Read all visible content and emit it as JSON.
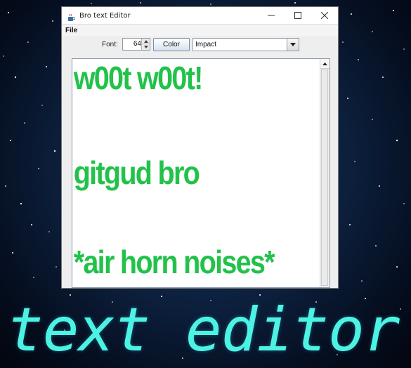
{
  "window": {
    "title": "Bro text Editor",
    "controls": [
      "minimize",
      "maximize",
      "close"
    ]
  },
  "menu": {
    "items": [
      {
        "label": "File"
      }
    ]
  },
  "toolbar": {
    "font_label": "Font:",
    "font_size_value": "64",
    "color_button_label": "Color",
    "font_family_selected": "Impact"
  },
  "editor": {
    "text_color": "#22c24a",
    "lines": [
      "w00t w00t!",
      "gitgud bro",
      "*air horn noises*"
    ]
  },
  "banner": {
    "text": "text editor",
    "color": "#4df3e2"
  },
  "colors": {
    "titlebar": "#ffffff",
    "window_bg": "#eeeeee",
    "background_space": "#0d2240"
  }
}
